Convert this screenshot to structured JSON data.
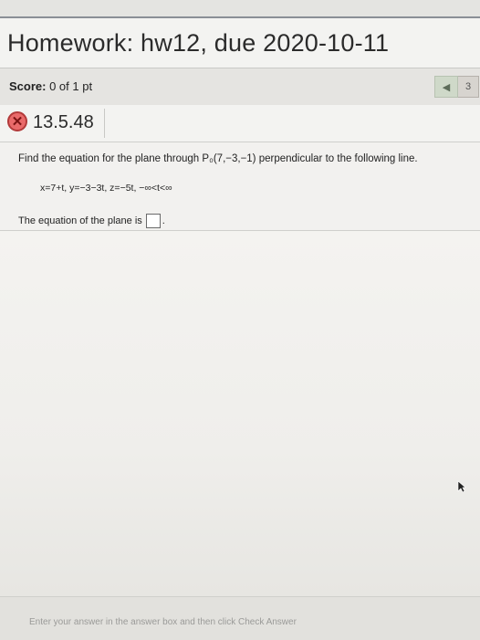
{
  "header": {
    "title": "Homework: hw12, due 2020-10-11"
  },
  "score": {
    "label": "Score:",
    "value": "0 of 1 pt"
  },
  "navigation": {
    "prev_icon": "triangle-left-icon",
    "question_count": "3"
  },
  "question": {
    "status_icon": "wrong-x-icon",
    "status_color": "#e96a6a",
    "number": "13.5.48",
    "prompt": "Find the equation for the plane through P₀(7,−3,−1) perpendicular to the following line.",
    "line_equation": "x=7+t, y=−3−3t, z=−5t, −∞<t<∞",
    "answer_label": "The equation of the plane is",
    "answer_value": "",
    "answer_suffix": "."
  },
  "footer": {
    "instruction": "Enter your answer in the answer box and then click Check Answer"
  }
}
